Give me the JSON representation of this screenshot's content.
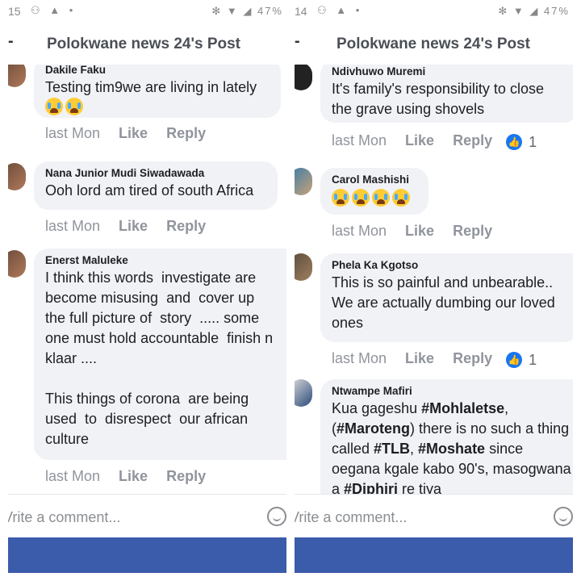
{
  "left": {
    "status": {
      "time": "15",
      "battery": "47%"
    },
    "header": {
      "title": "Polokwane news 24's Post"
    },
    "comments": [
      {
        "name": "Dakile Faku",
        "text": "Testing tim9we are living in lately",
        "time": "last Mon",
        "like": "Like",
        "reply": "Reply"
      },
      {
        "name": "Nana Junior Mudi Siwadawada",
        "text": "Ooh lord am tired of south Africa",
        "time": "last Mon",
        "like": "Like",
        "reply": "Reply"
      },
      {
        "name": "Enerst Maluleke",
        "text": "I think this words  investigate are\nbecome misusing  and  cover up\nthe full picture of  story  ..... some\none must hold accountable  finish n\nklaar ....\n\nThis things of corona  are being\nused  to  disrespect  our african\nculture",
        "time": "last Mon",
        "like": "Like",
        "reply": "Reply"
      }
    ],
    "composer": {
      "placeholder": "Vrite a comment..."
    }
  },
  "right": {
    "status": {
      "time": "14",
      "battery": "47%"
    },
    "header": {
      "title": "Polokwane news 24's Post"
    },
    "comments": [
      {
        "name": "Ndivhuwo Muremi",
        "text": "It's family's responsibility to close\nthe grave using shovels",
        "time": "last Mon",
        "like": "Like",
        "reply": "Reply",
        "reactions": "1"
      },
      {
        "name": "Carol Mashishi",
        "text": "",
        "time": "last Mon",
        "like": "Like",
        "reply": "Reply"
      },
      {
        "name": "Phela Ka Kgotso",
        "text": "This is so painful and unbearable..\nWe are actually dumbing our loved\nones",
        "time": "last Mon",
        "like": "Like",
        "reply": "Reply",
        "reactions": "1"
      },
      {
        "name": "Ntwampe Mafiri",
        "text_parts": [
          "Kua gageshu ",
          "#Mohlaletse",
          ",(",
          "#Maroteng",
          ") there is no such a thing called ",
          "#TLB",
          ", ",
          "#Moshate",
          " since oegana kgale kabo 90's, masogwana a ",
          "#Diphiri",
          " re tiya"
        ]
      }
    ],
    "composer": {
      "placeholder": "Vrite a comment..."
    }
  },
  "colors": {
    "bubble": "#f0f2f5",
    "action": "#90949c",
    "bar": "#3b5bab",
    "reaction": "#1877f2"
  }
}
